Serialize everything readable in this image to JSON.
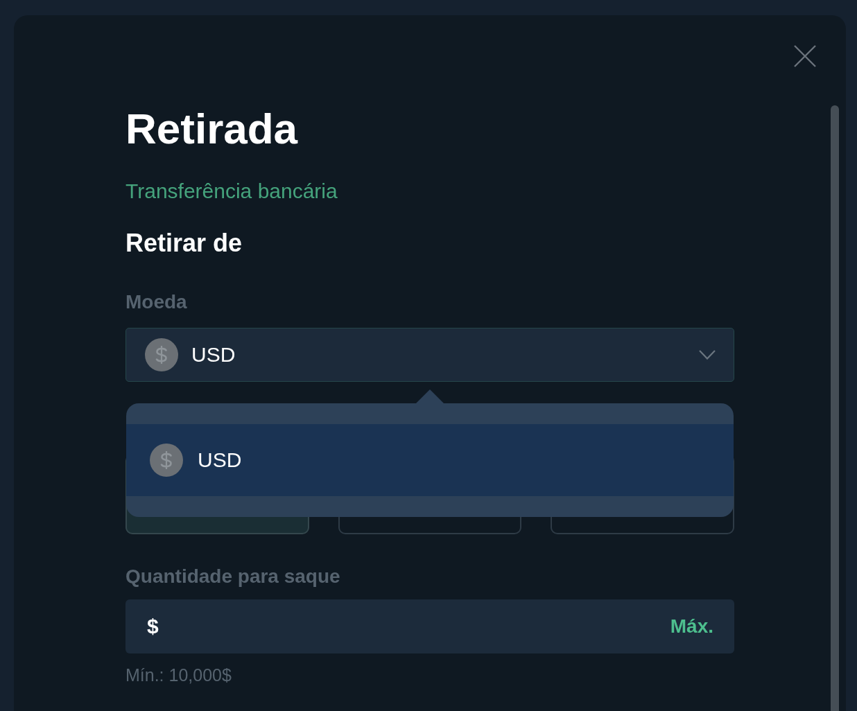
{
  "dialog": {
    "title": "Retirada",
    "method": "Transferência bancária",
    "section_title": "Retirar de"
  },
  "currency": {
    "label": "Moeda",
    "value": "USD",
    "expanded": true,
    "options": [
      {
        "label": "USD",
        "selected": true
      }
    ]
  },
  "option_cards": [
    {
      "selected": true
    },
    {
      "selected": false
    },
    {
      "selected": false
    }
  ],
  "amount": {
    "label": "Quantidade para saque",
    "prefix": "$",
    "max_button": "Máx.",
    "hint": "Mín.: 10,000$"
  }
}
